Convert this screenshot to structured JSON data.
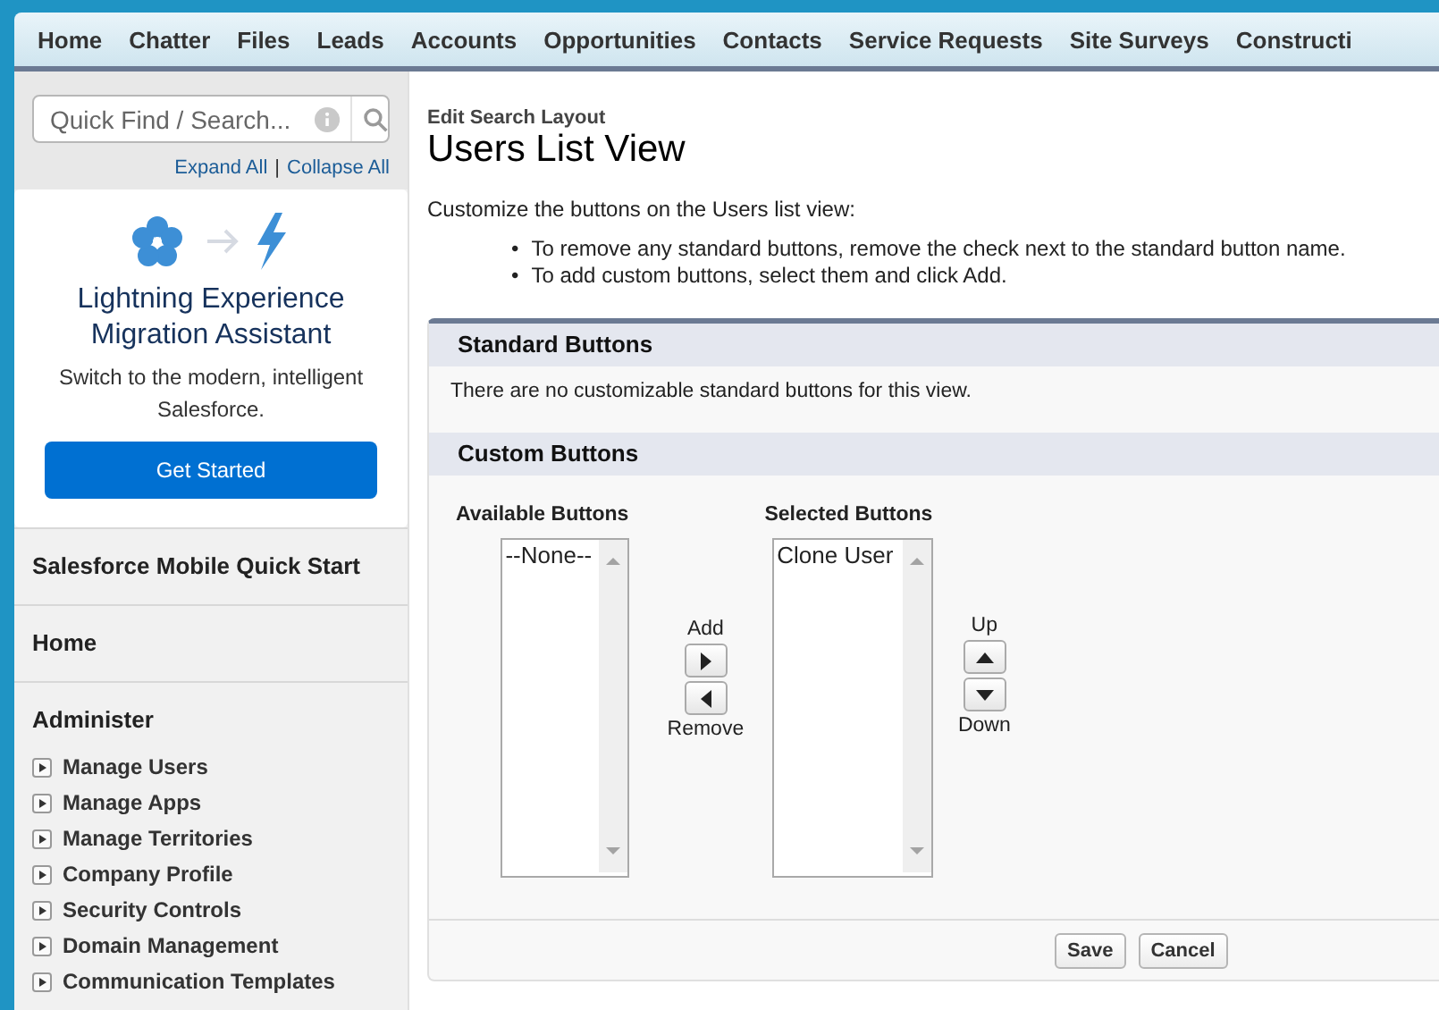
{
  "tabs": [
    {
      "label": "Home"
    },
    {
      "label": "Chatter"
    },
    {
      "label": "Files"
    },
    {
      "label": "Leads"
    },
    {
      "label": "Accounts"
    },
    {
      "label": "Opportunities"
    },
    {
      "label": "Contacts"
    },
    {
      "label": "Service Requests"
    },
    {
      "label": "Site Surveys"
    },
    {
      "label": "Constructi"
    }
  ],
  "sidebar": {
    "search": {
      "placeholder": "Quick Find / Search..."
    },
    "expand_all": "Expand All",
    "separator": "|",
    "collapse_all": "Collapse All",
    "promo": {
      "title_lines": [
        "Lightning Experience",
        "Migration Assistant"
      ],
      "text": "Switch to the modern, intelligent Salesforce.",
      "button": "Get Started"
    },
    "sections": [
      {
        "title": "Salesforce Mobile Quick Start"
      },
      {
        "title": "Home"
      },
      {
        "title": "Administer",
        "items": [
          "Manage Users",
          "Manage Apps",
          "Manage Territories",
          "Company Profile",
          "Security Controls",
          "Domain Management",
          "Communication Templates"
        ]
      }
    ]
  },
  "main": {
    "breadcrumb": "Edit Search Layout",
    "title": "Users List View",
    "intro": "Customize the buttons on the Users list view:",
    "bullet_marker": "•",
    "bullets": [
      "To remove any standard buttons, remove the check next to the standard button name.",
      "To add custom buttons, select them and click Add."
    ],
    "standard": {
      "title": "Standard Buttons",
      "message": "There are no customizable standard buttons for this view."
    },
    "custom": {
      "title": "Custom Buttons",
      "available": {
        "label": "Available Buttons",
        "options": [
          "--None--"
        ]
      },
      "selected": {
        "label": "Selected Buttons",
        "options": [
          "Clone User"
        ]
      },
      "add": "Add",
      "remove": "Remove",
      "up": "Up",
      "down": "Down"
    },
    "buttons": [
      "Save",
      "Cancel"
    ]
  }
}
